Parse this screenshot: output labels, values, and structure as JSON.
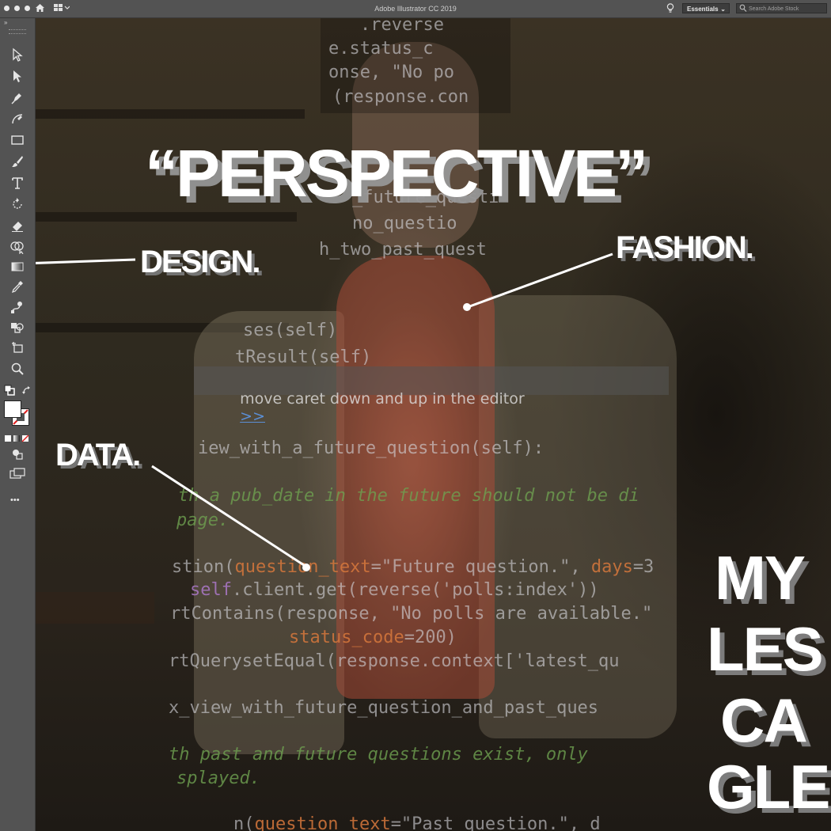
{
  "window": {
    "app_title": "Adobe Illustrator CC 2019",
    "workspace": "Essentials",
    "search_placeholder": "Search Adobe Stock"
  },
  "toolbar": {
    "tools": [
      "selection-tool",
      "direct-selection-tool",
      "pen-tool",
      "curvature-tool",
      "rectangle-tool",
      "paintbrush-tool",
      "type-tool",
      "rotate-tool",
      "eraser-tool",
      "shape-builder-tool",
      "gradient-tool",
      "eyedropper-tool",
      "blend-tool",
      "live-paint-tool",
      "artboard-tool",
      "zoom-tool"
    ],
    "more_label": "•••"
  },
  "artwork": {
    "title": "“PERSPECTIVE”",
    "labels": {
      "design": "DESIGN.",
      "fashion": "FASHION.",
      "data": "DATA."
    },
    "side_words": [
      "MY",
      "LES",
      "CA",
      "GLE"
    ]
  },
  "code_overlay": {
    "top_lines": [
      ".reverse",
      "e.status_c",
      "onse, \"No po",
      "(response.con"
    ],
    "mid_lines": [
      "_future_questi",
      "no_questio",
      "h_two_past_quest",
      "ses(self)",
      "tResult(self)"
    ],
    "hint": "move caret down and up in the editor",
    "hint_link": ">>",
    "def_line": "iew_with_a_future_question(self):",
    "comment1": "th a pub_date in the future should not be di",
    "comment2": "page.",
    "q1_a": "stion(",
    "q1_b": "question_text",
    "q1_c": "=\"Future question.\", ",
    "q1_d": "days",
    "q1_e": "=3",
    "get_self": "self",
    "get_rest": ".client.get(reverse('polls:index'))",
    "contains": "rtContains(response, \"No polls are available.\"",
    "status_a": "status_code",
    "status_b": "=200)",
    "qs": "rtQuerysetEqual(response.context['latest_qu",
    "def2": "x_view_with_future_question_and_past_ques",
    "comment3": "th past and future questions exist, only",
    "comment4": "splayed.",
    "last_a": "n(",
    "last_b": "question_text",
    "last_c": "=\"Past question.\", d"
  }
}
